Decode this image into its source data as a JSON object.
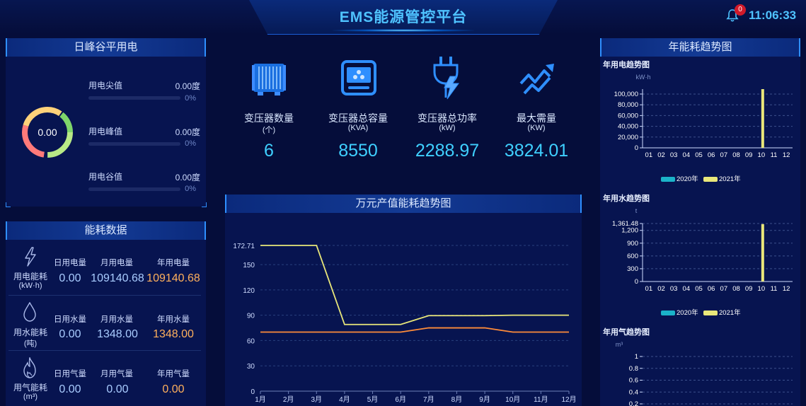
{
  "header": {
    "title": "EMS能源管控平台",
    "time": "11:06:33",
    "notification_count": "0"
  },
  "peak_panel": {
    "title": "日峰谷平用电",
    "donut_value": "0.00",
    "rows": [
      {
        "label": "用电尖值",
        "value": "0.00度",
        "percent": "0%"
      },
      {
        "label": "用电峰值",
        "value": "0.00度",
        "percent": "0%"
      },
      {
        "label": "用电谷值",
        "value": "0.00度",
        "percent": "0%"
      }
    ]
  },
  "energy_panel": {
    "title": "能耗数据",
    "rows": [
      {
        "name": "用电能耗",
        "unit": "(kW·h)",
        "heads": [
          "日用电量",
          "月用电量",
          "年用电量"
        ],
        "values": [
          "0.00",
          "109140.68",
          "109140.68"
        ]
      },
      {
        "name": "用水能耗",
        "unit": "(吨)",
        "heads": [
          "日用水量",
          "月用水量",
          "年用水量"
        ],
        "values": [
          "0.00",
          "1348.00",
          "1348.00"
        ]
      },
      {
        "name": "用气能耗",
        "unit": "(m³)",
        "heads": [
          "日用气量",
          "月用气量",
          "年用气量"
        ],
        "values": [
          "0.00",
          "0.00",
          "0.00"
        ]
      }
    ]
  },
  "stats": [
    {
      "label": "变压器数量",
      "unit": "(个)",
      "value": "6",
      "icon": "transformer-icon"
    },
    {
      "label": "变压器总容量",
      "unit": "(KVA)",
      "value": "8550",
      "icon": "capacity-icon"
    },
    {
      "label": "变压器总功率",
      "unit": "(kW)",
      "value": "2288.97",
      "icon": "plug-icon"
    },
    {
      "label": "最大需量",
      "unit": "(KW)",
      "value": "3824.01",
      "icon": "trend-icon"
    }
  ],
  "trend_panel": {
    "title": "年能耗趋势图"
  },
  "colors": {
    "accent": "#3fd0ff",
    "series_2020": "#1bb3c9",
    "series_2021": "#e9e77a",
    "orange": "#ff8c3a"
  },
  "chart_data": [
    {
      "type": "line",
      "title": "万元产值能耗趋势图",
      "categories": [
        "1月",
        "2月",
        "3月",
        "4月",
        "5月",
        "6月",
        "7月",
        "8月",
        "9月",
        "10月",
        "11月",
        "12月"
      ],
      "series": [
        {
          "values": [
            172.71,
            172.71,
            172.71,
            79,
            79,
            79,
            89.5,
            89.5,
            89.5,
            90,
            90,
            90
          ]
        },
        {
          "values": [
            70,
            70,
            70,
            70,
            70,
            70,
            75,
            75,
            75,
            70,
            70,
            70
          ]
        }
      ],
      "yticks": [
        "0",
        "30",
        "60",
        "90",
        "120",
        "150",
        "172.71"
      ],
      "ylim": [
        0,
        172.71
      ],
      "grid": true
    },
    {
      "type": "bar",
      "title": "年用电趋势图",
      "ylabel": "kW·h",
      "categories": [
        "01",
        "02",
        "03",
        "04",
        "05",
        "06",
        "07",
        "08",
        "09",
        "10",
        "11",
        "12"
      ],
      "series": [
        {
          "name": "2020年",
          "values": [
            0,
            0,
            0,
            0,
            0,
            0,
            0,
            0,
            0,
            0,
            0,
            0
          ]
        },
        {
          "name": "2021年",
          "values": [
            0,
            0,
            0,
            0,
            0,
            0,
            0,
            0,
            0,
            109140.68,
            0,
            0
          ]
        }
      ],
      "yticks": [
        "0",
        "20,000",
        "40,000",
        "60,000",
        "80,000",
        "100,000"
      ],
      "ylim": [
        0,
        109140.68
      ],
      "legend": "bottom"
    },
    {
      "type": "bar",
      "title": "年用水趋势图",
      "ylabel": "t",
      "categories": [
        "01",
        "02",
        "03",
        "04",
        "05",
        "06",
        "07",
        "08",
        "09",
        "10",
        "11",
        "12"
      ],
      "series": [
        {
          "name": "2020年",
          "values": [
            0,
            0,
            0,
            0,
            0,
            0,
            0,
            0,
            0,
            0,
            0,
            0
          ]
        },
        {
          "name": "2021年",
          "values": [
            0,
            0,
            0,
            0,
            0,
            0,
            0,
            0,
            0,
            1348,
            0,
            0
          ]
        }
      ],
      "yticks": [
        "0",
        "300",
        "600",
        "900",
        "1,200",
        "1,361.48"
      ],
      "ylim": [
        0,
        1361.48
      ],
      "legend": "bottom"
    },
    {
      "type": "bar",
      "title": "年用气趋势图",
      "ylabel": "m³",
      "categories": [],
      "series": [],
      "yticks": [
        "0.2",
        "0.4",
        "0.6",
        "0.8",
        "1"
      ],
      "ylim": [
        0.2,
        1
      ]
    }
  ]
}
